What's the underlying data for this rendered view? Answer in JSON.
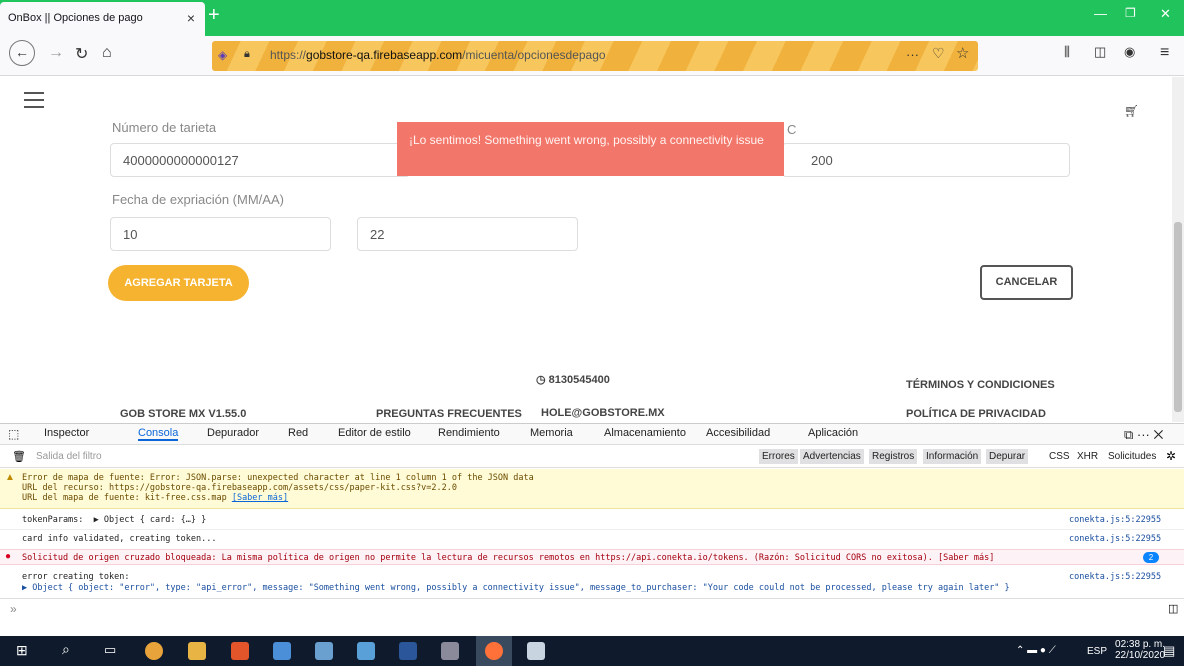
{
  "browser": {
    "tab_title": "OnBox || Opciones de pago",
    "tab_close": "×",
    "new_tab": "+",
    "url_prefix": "https://",
    "url_host": "gobstore-qa.firebaseapp.com",
    "url_path": "/micuenta/opcionesdepago",
    "url_more": "···"
  },
  "page": {
    "card_number_label": "Número de tarjeta",
    "card_number_value": "4000000000000127",
    "cvc_label": "C",
    "cvc_value": "200",
    "expiry_label": "Fecha de expriación (MM/AA)",
    "month_value": "10",
    "year_value": "22",
    "add_button": "AGREGAR TARJETA",
    "cancel_button": "CANCELAR",
    "toast_message": "¡Lo sentimos! Something went wrong, possibly a connectivity issue"
  },
  "footer": {
    "version": "GOB STORE MX V1.55.0",
    "faq": "PREGUNTAS FRECUENTES",
    "phone": "8130545400",
    "email": "HOLE@GOBSTORE.MX",
    "terms": "TÉRMINOS Y CONDICIONES",
    "privacy": "POLÍTICA DE PRIVACIDAD"
  },
  "devtools": {
    "tabs": [
      "Inspector",
      "Consola",
      "Depurador",
      "Red",
      "Editor de estilo",
      "Rendimiento",
      "Memoria",
      "Almacenamiento",
      "Accesibilidad",
      "Aplicación"
    ],
    "filter_placeholder": "Salida del filtro",
    "filters": [
      "Errores",
      "Advertencias",
      "Registros",
      "Información",
      "Depurar",
      "CSS",
      "XHR",
      "Solicitudes"
    ],
    "messages": {
      "warn_line1": "Error de mapa de fuente: Error: JSON.parse: unexpected character at line 1 column 1 of the JSON data",
      "warn_line2": "URL del recurso: https://gobstore-qa.firebaseapp.com/assets/css/paper-kit.css?v=2.2.0",
      "warn_line3": "URL del mapa de fuente: kit-free.css.map",
      "warn_link": "[Saber más]",
      "log1": "tokenParams:  ▶ Object { card: {…} }",
      "log2": "card info validated, creating token...",
      "error_cors": "Solicitud de origen cruzado bloqueada: La misma política de origen no permite la lectura de recursos remotos en https://api.conekta.io/tokens. (Razón: Solicitud CORS no exitosa). [Saber más]",
      "error_count": "2",
      "log3": "error creating token:",
      "log3_detail": "▶ Object { object: \"error\", type: \"api_error\", message: \"Something went wrong, possibly a connectivity issue\", message_to_purchaser: \"Your code could not be processed, please try again later\" }",
      "source": "conekta.js:5:22955",
      "prompt": "»"
    }
  },
  "taskbar": {
    "lang": "ESP",
    "time": "02:38 p. m.",
    "date": "22/10/2020"
  },
  "colors": {
    "titlebar": "#21c45c",
    "toast": "#f3766a",
    "accent": "#f5b32f"
  }
}
